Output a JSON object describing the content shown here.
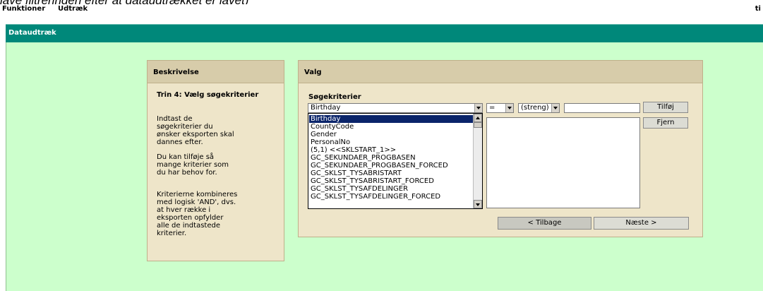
{
  "caption": "lave filtreringen efter at dataudtrækket er lavet)",
  "menu": {
    "items": [
      "Funktioner",
      "Udtræk"
    ],
    "right_fragment": "ti"
  },
  "window": {
    "title": "Dataudtræk"
  },
  "description_panel": {
    "header": "Beskrivelse",
    "step_title": "Trin 4: Vælg søgekriterier",
    "paragraphs": [
      "Indtast de søgekriterier du ønsker eksporten skal dannes efter.",
      "Du kan tilføje så mange kriterier som du har behov for.",
      "Kriterierne kombineres med logisk 'AND', dvs. at hver række i eksporten opfylder alle de indtastede kriterier."
    ]
  },
  "choice_panel": {
    "header": "Valg",
    "criteria_label": "Søgekriterier",
    "field_select": {
      "value": "Birthday"
    },
    "operator_select": {
      "value": "="
    },
    "type_select": {
      "value": "(streng)"
    },
    "value_input": {
      "value": ""
    },
    "add_button": "Tilføj",
    "remove_button": "Fjern",
    "back_button": "< Tilbage",
    "next_button": "Næste >",
    "dropdown": {
      "selected_index": 0,
      "options": [
        "Birthday",
        "CountyCode",
        "Gender",
        "PersonalNo",
        "(5,1) <<SKLSTART_1>>",
        "GC_SEKUNDAER_PROGBASEN",
        "GC_SEKUNDAER_PROGBASEN_FORCED",
        "GC_SKLST_TYSABRISTART",
        "GC_SKLST_TYSABRISTART_FORCED",
        "GC_SKLST_TYSAFDELINGER",
        "GC_SKLST_TYSAFDELINGER_FORCED"
      ]
    }
  }
}
